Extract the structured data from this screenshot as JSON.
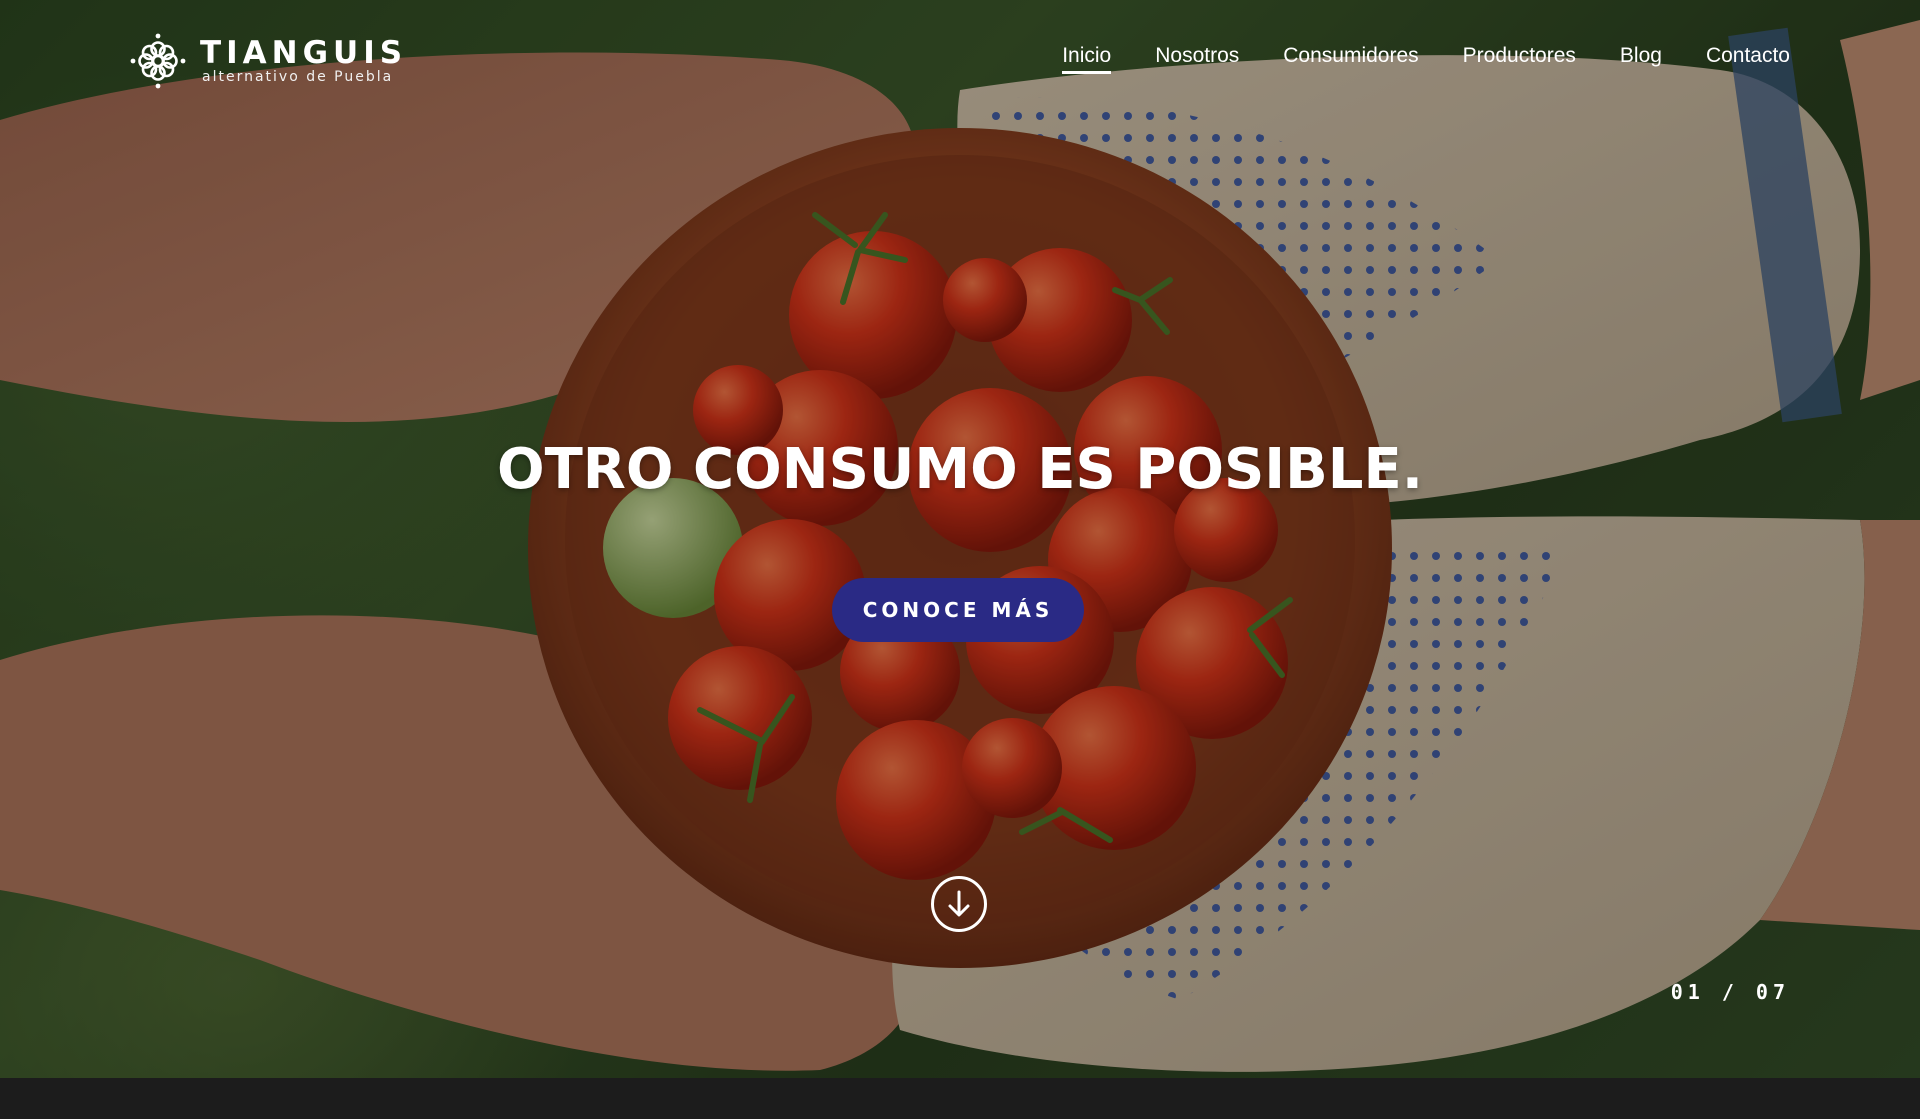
{
  "brand": {
    "name": "TIANGUIS",
    "tagline": "alternativo de Puebla",
    "logo_icon": "flower-mandala-icon"
  },
  "nav": {
    "items": [
      {
        "label": "Inicio",
        "active": true
      },
      {
        "label": "Nosotros",
        "active": false
      },
      {
        "label": "Consumidores",
        "active": false
      },
      {
        "label": "Productores",
        "active": false
      },
      {
        "label": "Blog",
        "active": false
      },
      {
        "label": "Contacto",
        "active": false
      }
    ]
  },
  "hero": {
    "headline": "OTRO CONSUMO ES POSIBLE.",
    "cta_label": "CONOCE MÁS",
    "scroll_icon": "arrow-down-circle-icon",
    "slide_counter": "01 / 07"
  },
  "colors": {
    "accent": "#2a2a85",
    "text": "#ffffff",
    "bottom_bar": "#1c1c1c"
  }
}
